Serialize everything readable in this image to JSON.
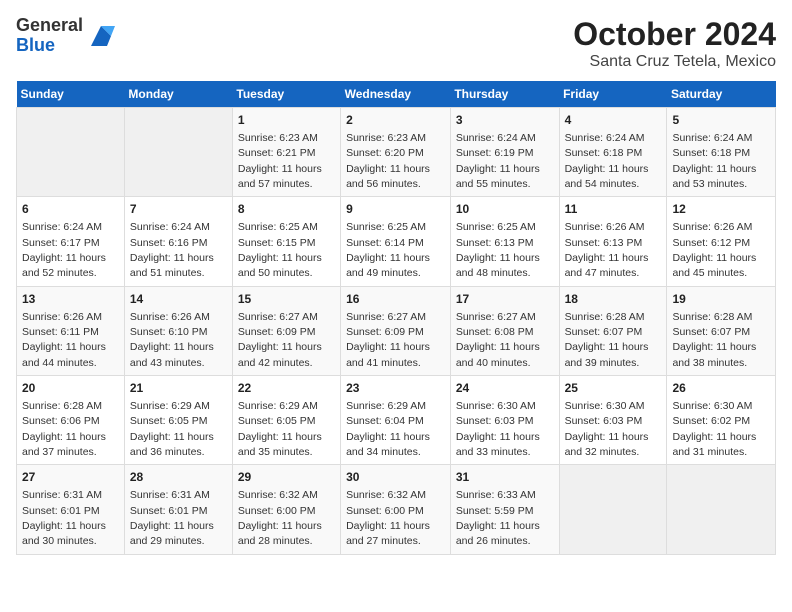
{
  "logo": {
    "general": "General",
    "blue": "Blue"
  },
  "title": "October 2024",
  "subtitle": "Santa Cruz Tetela, Mexico",
  "days_of_week": [
    "Sunday",
    "Monday",
    "Tuesday",
    "Wednesday",
    "Thursday",
    "Friday",
    "Saturday"
  ],
  "weeks": [
    [
      {
        "day": "",
        "info": ""
      },
      {
        "day": "",
        "info": ""
      },
      {
        "day": "1",
        "info": "Sunrise: 6:23 AM\nSunset: 6:21 PM\nDaylight: 11 hours and 57 minutes."
      },
      {
        "day": "2",
        "info": "Sunrise: 6:23 AM\nSunset: 6:20 PM\nDaylight: 11 hours and 56 minutes."
      },
      {
        "day": "3",
        "info": "Sunrise: 6:24 AM\nSunset: 6:19 PM\nDaylight: 11 hours and 55 minutes."
      },
      {
        "day": "4",
        "info": "Sunrise: 6:24 AM\nSunset: 6:18 PM\nDaylight: 11 hours and 54 minutes."
      },
      {
        "day": "5",
        "info": "Sunrise: 6:24 AM\nSunset: 6:18 PM\nDaylight: 11 hours and 53 minutes."
      }
    ],
    [
      {
        "day": "6",
        "info": "Sunrise: 6:24 AM\nSunset: 6:17 PM\nDaylight: 11 hours and 52 minutes."
      },
      {
        "day": "7",
        "info": "Sunrise: 6:24 AM\nSunset: 6:16 PM\nDaylight: 11 hours and 51 minutes."
      },
      {
        "day": "8",
        "info": "Sunrise: 6:25 AM\nSunset: 6:15 PM\nDaylight: 11 hours and 50 minutes."
      },
      {
        "day": "9",
        "info": "Sunrise: 6:25 AM\nSunset: 6:14 PM\nDaylight: 11 hours and 49 minutes."
      },
      {
        "day": "10",
        "info": "Sunrise: 6:25 AM\nSunset: 6:13 PM\nDaylight: 11 hours and 48 minutes."
      },
      {
        "day": "11",
        "info": "Sunrise: 6:26 AM\nSunset: 6:13 PM\nDaylight: 11 hours and 47 minutes."
      },
      {
        "day": "12",
        "info": "Sunrise: 6:26 AM\nSunset: 6:12 PM\nDaylight: 11 hours and 45 minutes."
      }
    ],
    [
      {
        "day": "13",
        "info": "Sunrise: 6:26 AM\nSunset: 6:11 PM\nDaylight: 11 hours and 44 minutes."
      },
      {
        "day": "14",
        "info": "Sunrise: 6:26 AM\nSunset: 6:10 PM\nDaylight: 11 hours and 43 minutes."
      },
      {
        "day": "15",
        "info": "Sunrise: 6:27 AM\nSunset: 6:09 PM\nDaylight: 11 hours and 42 minutes."
      },
      {
        "day": "16",
        "info": "Sunrise: 6:27 AM\nSunset: 6:09 PM\nDaylight: 11 hours and 41 minutes."
      },
      {
        "day": "17",
        "info": "Sunrise: 6:27 AM\nSunset: 6:08 PM\nDaylight: 11 hours and 40 minutes."
      },
      {
        "day": "18",
        "info": "Sunrise: 6:28 AM\nSunset: 6:07 PM\nDaylight: 11 hours and 39 minutes."
      },
      {
        "day": "19",
        "info": "Sunrise: 6:28 AM\nSunset: 6:07 PM\nDaylight: 11 hours and 38 minutes."
      }
    ],
    [
      {
        "day": "20",
        "info": "Sunrise: 6:28 AM\nSunset: 6:06 PM\nDaylight: 11 hours and 37 minutes."
      },
      {
        "day": "21",
        "info": "Sunrise: 6:29 AM\nSunset: 6:05 PM\nDaylight: 11 hours and 36 minutes."
      },
      {
        "day": "22",
        "info": "Sunrise: 6:29 AM\nSunset: 6:05 PM\nDaylight: 11 hours and 35 minutes."
      },
      {
        "day": "23",
        "info": "Sunrise: 6:29 AM\nSunset: 6:04 PM\nDaylight: 11 hours and 34 minutes."
      },
      {
        "day": "24",
        "info": "Sunrise: 6:30 AM\nSunset: 6:03 PM\nDaylight: 11 hours and 33 minutes."
      },
      {
        "day": "25",
        "info": "Sunrise: 6:30 AM\nSunset: 6:03 PM\nDaylight: 11 hours and 32 minutes."
      },
      {
        "day": "26",
        "info": "Sunrise: 6:30 AM\nSunset: 6:02 PM\nDaylight: 11 hours and 31 minutes."
      }
    ],
    [
      {
        "day": "27",
        "info": "Sunrise: 6:31 AM\nSunset: 6:01 PM\nDaylight: 11 hours and 30 minutes."
      },
      {
        "day": "28",
        "info": "Sunrise: 6:31 AM\nSunset: 6:01 PM\nDaylight: 11 hours and 29 minutes."
      },
      {
        "day": "29",
        "info": "Sunrise: 6:32 AM\nSunset: 6:00 PM\nDaylight: 11 hours and 28 minutes."
      },
      {
        "day": "30",
        "info": "Sunrise: 6:32 AM\nSunset: 6:00 PM\nDaylight: 11 hours and 27 minutes."
      },
      {
        "day": "31",
        "info": "Sunrise: 6:33 AM\nSunset: 5:59 PM\nDaylight: 11 hours and 26 minutes."
      },
      {
        "day": "",
        "info": ""
      },
      {
        "day": "",
        "info": ""
      }
    ]
  ]
}
